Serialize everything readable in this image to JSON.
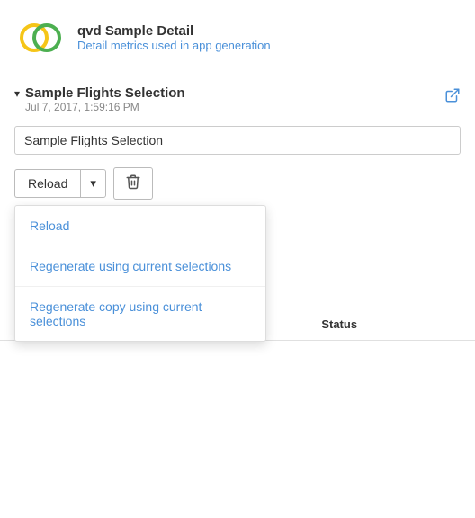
{
  "header": {
    "title": "qvd Sample Detail",
    "subtitle_prefix": "Detail metrics used ",
    "subtitle_link": "in",
    "subtitle_suffix": " app generation"
  },
  "section": {
    "title": "Sample Flights Selection",
    "subtitle": "Jul 7, 2017, 1:59:16 PM"
  },
  "input": {
    "value": "Sample Flights Selection",
    "placeholder": "Sample Flights Selection"
  },
  "buttons": {
    "reload": "Reload",
    "dropdown_arrow": "▾",
    "trash_icon": "🗑"
  },
  "table": {
    "col_name": "",
    "col_status": "Status"
  },
  "dropdown": {
    "items": [
      {
        "label": "Reload"
      },
      {
        "label": "Regenerate using current selections"
      },
      {
        "label": "Regenerate copy using current selections"
      }
    ]
  },
  "icons": {
    "external_link": "⬡",
    "chevron": "▾"
  }
}
